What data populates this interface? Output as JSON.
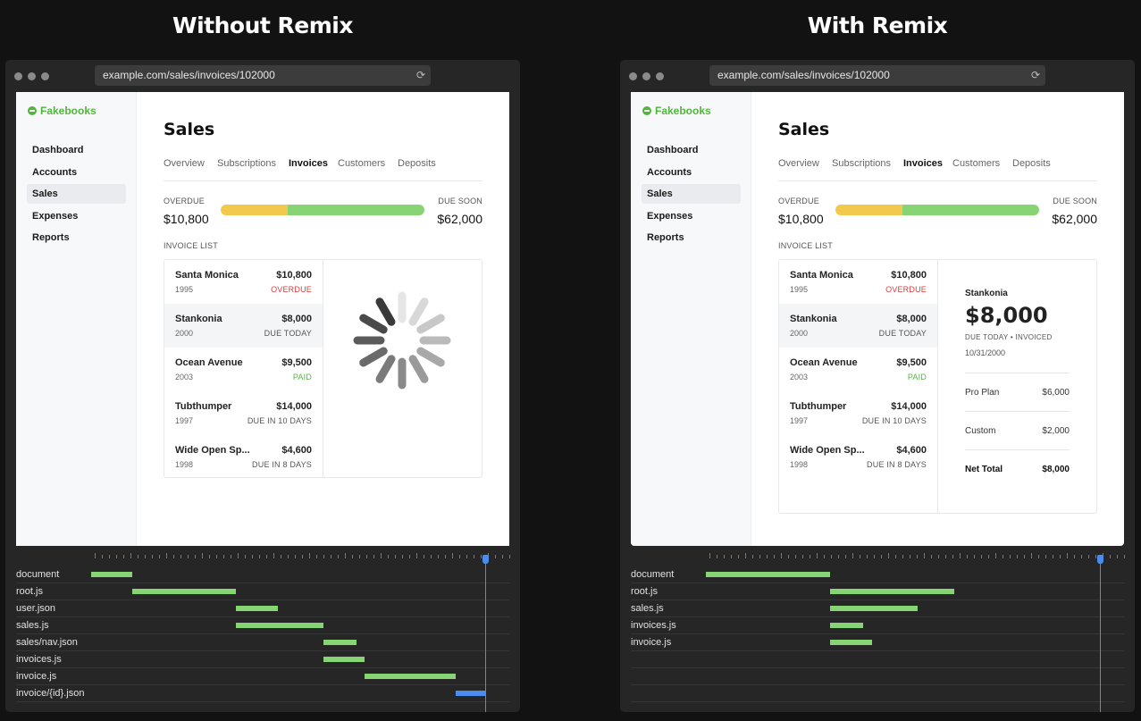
{
  "headings": {
    "left": "Without Remix",
    "right": "With Remix"
  },
  "colors": {
    "brand": "#53b53e",
    "overdue_bar": "#f2c94c",
    "due_soon_bar": "#86d474",
    "timeline_bar": "#86d474",
    "timeline_active_bar": "#4a8cf0",
    "cursor": "#4a8cf0",
    "status_overdue": "#e03b3b",
    "status_paid": "#53b53e"
  },
  "browser": {
    "url": "example.com/sales/invoices/102000",
    "reload_icon": "reload-icon"
  },
  "app": {
    "brand": "Fakebooks",
    "nav": [
      "Dashboard",
      "Accounts",
      "Sales",
      "Expenses",
      "Reports"
    ],
    "nav_active": "Sales",
    "title": "Sales",
    "tabs": [
      "Overview",
      "Subscriptions",
      "Invoices",
      "Customers",
      "Deposits"
    ],
    "tab_active": "Invoices",
    "overdue_label": "OVERDUE",
    "overdue_amount": "$10,800",
    "due_soon_label": "DUE SOON",
    "due_soon_amount": "$62,000",
    "bar_overdue_fraction": 0.33,
    "invoice_list_label": "INVOICE LIST",
    "invoices": [
      {
        "name": "Santa Monica",
        "year": "1995",
        "amount": "$10,800",
        "status": "OVERDUE",
        "status_kind": "overdue"
      },
      {
        "name": "Stankonia",
        "year": "2000",
        "amount": "$8,000",
        "status": "DUE TODAY",
        "status_kind": "normal"
      },
      {
        "name": "Ocean Avenue",
        "year": "2003",
        "amount": "$9,500",
        "status": "PAID",
        "status_kind": "paid"
      },
      {
        "name": "Tubthumper",
        "year": "1997",
        "amount": "$14,000",
        "status": "DUE IN 10 DAYS",
        "status_kind": "normal"
      },
      {
        "name": "Wide Open Sp...",
        "year": "1998",
        "amount": "$4,600",
        "status": "DUE IN 8 DAYS",
        "status_kind": "normal"
      }
    ],
    "active_invoice_index": 1
  },
  "detail": {
    "name": "Stankonia",
    "amount": "$8,000",
    "status": "DUE TODAY • INVOICED",
    "date": "10/31/2000",
    "lines": [
      {
        "label": "Pro Plan",
        "value": "$6,000"
      },
      {
        "label": "Custom",
        "value": "$2,000"
      },
      {
        "label": "Net Total",
        "value": "$8,000"
      }
    ]
  },
  "timeline_left": {
    "rows": [
      {
        "label": "document",
        "start": 0,
        "end": 0.1
      },
      {
        "label": "root.js",
        "start": 0.1,
        "end": 0.35
      },
      {
        "label": "user.json",
        "start": 0.35,
        "end": 0.45
      },
      {
        "label": "sales.js",
        "start": 0.35,
        "end": 0.56
      },
      {
        "label": "sales/nav.json",
        "start": 0.56,
        "end": 0.64
      },
      {
        "label": "invoices.js",
        "start": 0.56,
        "end": 0.66
      },
      {
        "label": "invoice.js",
        "start": 0.66,
        "end": 0.88
      },
      {
        "label": "invoice/{id}.json",
        "start": 0.88,
        "end": 0.95,
        "active": true
      }
    ],
    "cursor": 0.95
  },
  "timeline_right": {
    "rows": [
      {
        "label": "document",
        "start": 0,
        "end": 0.3
      },
      {
        "label": "root.js",
        "start": 0.3,
        "end": 0.6
      },
      {
        "label": "sales.js",
        "start": 0.3,
        "end": 0.51
      },
      {
        "label": "invoices.js",
        "start": 0.3,
        "end": 0.38
      },
      {
        "label": "invoice.js",
        "start": 0.3,
        "end": 0.4
      }
    ],
    "cursor": 0.95,
    "empty_rows": 3
  }
}
